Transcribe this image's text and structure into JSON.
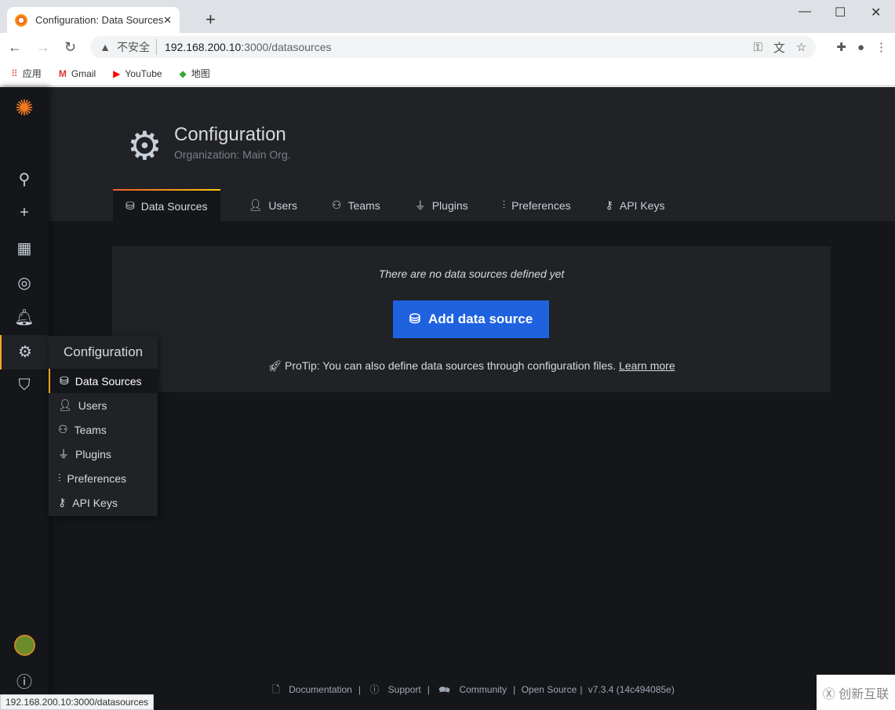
{
  "browser": {
    "tab_title": "Configuration: Data Sources - Grafana",
    "tab_title_visible": "Configuration: Data Sources - ",
    "url_insecure": "不安全",
    "url_host": "192.168.200.10",
    "url_path": ":3000/datasources",
    "bookmarks": [
      "应用",
      "Gmail",
      "YouTube",
      "地图"
    ],
    "status_url": "192.168.200.10:3000/datasources"
  },
  "page": {
    "title": "Configuration",
    "subtitle": "Organization: Main Org.",
    "tabs": [
      "Data Sources",
      "Users",
      "Teams",
      "Plugins",
      "Preferences",
      "API Keys"
    ]
  },
  "panel": {
    "empty_text": "There are no data sources defined yet",
    "add_button": "Add data source",
    "protip": "ProTip: You can also define data sources through configuration files.",
    "learn_more": "Learn more"
  },
  "menu": {
    "title": "Configuration",
    "items": [
      "Data Sources",
      "Users",
      "Teams",
      "Plugins",
      "Preferences",
      "API Keys"
    ]
  },
  "footer": {
    "documentation": "Documentation",
    "support": "Support",
    "community": "Community",
    "open_source": "Open Source",
    "version": "v7.3.4 (14c494085e)"
  },
  "watermark": "创新互联",
  "colors": {
    "accent": "#f5a623",
    "primary_button": "#1f62e0",
    "bg": "#141619",
    "panel": "#202226"
  }
}
